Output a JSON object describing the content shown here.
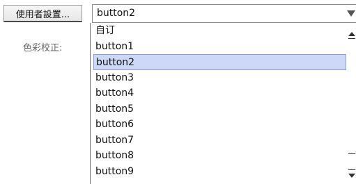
{
  "toolbar": {
    "user_settings_label": "使用者設置..."
  },
  "combo": {
    "value": "button2",
    "icon": "chevron-down-icon"
  },
  "color_correction": {
    "label": "色彩校正:"
  },
  "dropdown": {
    "items": [
      {
        "label": "自订"
      },
      {
        "label": "button1"
      },
      {
        "label": "button2",
        "selected": true
      },
      {
        "label": "button3"
      },
      {
        "label": "button4"
      },
      {
        "label": "button5"
      },
      {
        "label": "button6"
      },
      {
        "label": "button7"
      },
      {
        "label": "button8"
      },
      {
        "label": "button9"
      }
    ]
  },
  "colors": {
    "selection_bg": "#cdd8f7",
    "selection_border": "#8f9ec8"
  }
}
